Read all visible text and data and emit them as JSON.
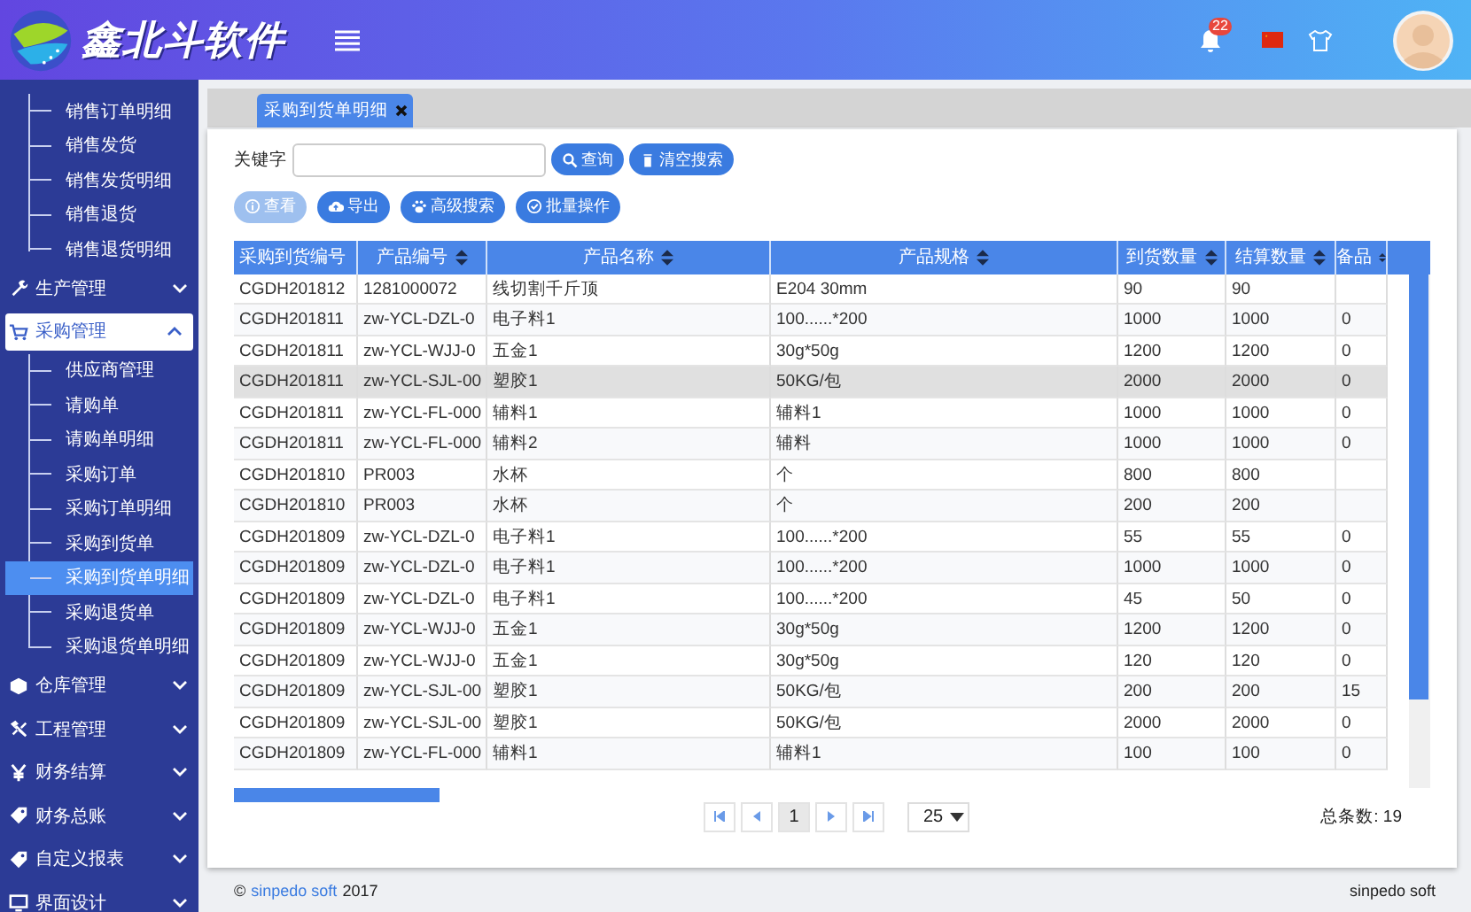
{
  "header": {
    "title": "鑫北斗软件",
    "notification_count": "22"
  },
  "sidebar": {
    "items_above": [
      {
        "label": "销售订单明细",
        "selected": false
      },
      {
        "label": "销售发货",
        "selected": false
      },
      {
        "label": "销售发货明细",
        "selected": false
      },
      {
        "label": "销售退货",
        "selected": false
      },
      {
        "label": "销售退货明细",
        "selected": false
      }
    ],
    "groups": [
      {
        "label": "生产管理",
        "expanded": false
      },
      {
        "label": "采购管理",
        "expanded": true,
        "children": [
          {
            "label": "供应商管理",
            "selected": false
          },
          {
            "label": "请购单",
            "selected": false
          },
          {
            "label": "请购单明细",
            "selected": false
          },
          {
            "label": "采购订单",
            "selected": false
          },
          {
            "label": "采购订单明细",
            "selected": false
          },
          {
            "label": "采购到货单",
            "selected": false
          },
          {
            "label": "采购到货单明细",
            "selected": true
          },
          {
            "label": "采购退货单",
            "selected": false
          },
          {
            "label": "采购退货单明细",
            "selected": false
          }
        ]
      },
      {
        "label": "仓库管理",
        "expanded": false
      },
      {
        "label": "工程管理",
        "expanded": false
      },
      {
        "label": "财务结算",
        "expanded": false
      },
      {
        "label": "财务总账",
        "expanded": false
      },
      {
        "label": "自定义报表",
        "expanded": false
      },
      {
        "label": "界面设计",
        "expanded": false
      }
    ]
  },
  "tabs": [
    {
      "label": "采购到货单明细",
      "selected": true
    }
  ],
  "search": {
    "label": "关键字",
    "buttons": [
      "查询",
      "清空搜索"
    ]
  },
  "actions": [
    {
      "label": "查看",
      "disabled": true
    },
    {
      "label": "导出",
      "disabled": false
    },
    {
      "label": "高级搜索",
      "disabled": false
    },
    {
      "label": "批量操作",
      "disabled": false
    }
  ],
  "table": {
    "columns": [
      {
        "label": "采购到货编号",
        "sortable": false
      },
      {
        "label": "产品编号",
        "sortable": true
      },
      {
        "label": "产品名称",
        "sortable": true
      },
      {
        "label": "产品规格",
        "sortable": true
      },
      {
        "label": "到货数量",
        "sortable": true
      },
      {
        "label": "结算数量",
        "sortable": true
      },
      {
        "label": "备品",
        "sortable": true
      }
    ],
    "rows": [
      {
        "selected": false,
        "cells": [
          "CGDH201812",
          "1281000072",
          "线切割千斤顶",
          "E204 30mm",
          "90",
          "90"
        ]
      },
      {
        "selected": false,
        "cells": [
          "CGDH201811",
          "zw-YCL-DZL-0",
          "电子料1",
          "100......*200",
          "1000",
          "1000",
          "0"
        ]
      },
      {
        "selected": false,
        "cells": [
          "CGDH201811",
          "zw-YCL-WJJ-0",
          "五金1",
          "30g*50g",
          "1200",
          "1200",
          "0"
        ]
      },
      {
        "selected": true,
        "cells": [
          "CGDH201811",
          "zw-YCL-SJL-00",
          "塑胶1",
          "50KG/包",
          "2000",
          "2000",
          "0"
        ]
      },
      {
        "selected": false,
        "cells": [
          "CGDH201811",
          "zw-YCL-FL-000",
          "辅料1",
          "辅料1",
          "1000",
          "1000",
          "0"
        ]
      },
      {
        "selected": false,
        "cells": [
          "CGDH201811",
          "zw-YCL-FL-000",
          "辅料2",
          "辅料",
          "1000",
          "1000",
          "0"
        ]
      },
      {
        "selected": false,
        "cells": [
          "CGDH201810",
          "PR003",
          "水杯",
          "个",
          "800",
          "800"
        ]
      },
      {
        "selected": false,
        "cells": [
          "CGDH201810",
          "PR003",
          "水杯",
          "个",
          "200",
          "200"
        ]
      },
      {
        "selected": false,
        "cells": [
          "CGDH201809",
          "zw-YCL-DZL-0",
          "电子料1",
          "100......*200",
          "55",
          "55",
          "0"
        ]
      },
      {
        "selected": false,
        "cells": [
          "CGDH201809",
          "zw-YCL-DZL-0",
          "电子料1",
          "100......*200",
          "1000",
          "1000",
          "0"
        ]
      },
      {
        "selected": false,
        "cells": [
          "CGDH201809",
          "zw-YCL-DZL-0",
          "电子料1",
          "100......*200",
          "45",
          "50",
          "0"
        ]
      },
      {
        "selected": false,
        "cells": [
          "CGDH201809",
          "zw-YCL-WJJ-0",
          "五金1",
          "30g*50g",
          "1200",
          "1200",
          "0"
        ]
      },
      {
        "selected": false,
        "cells": [
          "CGDH201809",
          "zw-YCL-WJJ-0",
          "五金1",
          "30g*50g",
          "120",
          "120",
          "0"
        ]
      },
      {
        "selected": false,
        "cells": [
          "CGDH201809",
          "zw-YCL-SJL-00",
          "塑胶1",
          "50KG/包",
          "200",
          "200",
          "15"
        ]
      },
      {
        "selected": false,
        "cells": [
          "CGDH201809",
          "zw-YCL-SJL-00",
          "塑胶1",
          "50KG/包",
          "2000",
          "2000",
          "0"
        ]
      },
      {
        "selected": false,
        "cells": [
          "CGDH201809",
          "zw-YCL-FL-000",
          "辅料1",
          "辅料1",
          "100",
          "100",
          "0"
        ]
      }
    ]
  },
  "pagination": {
    "current_page": "1",
    "page_size": "25",
    "total": "总条数: 19"
  },
  "footer": {
    "copyright_mark": "©",
    "company_link": "sinpedo soft",
    "year": "2017",
    "right_text": "sinpedo soft"
  }
}
